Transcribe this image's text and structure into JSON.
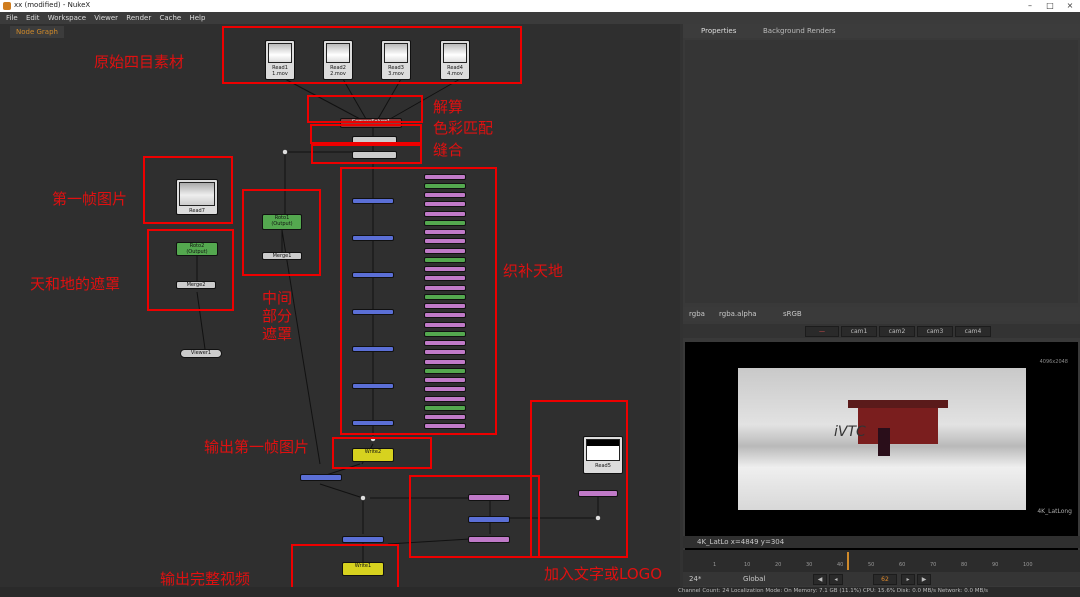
{
  "titlebar": {
    "title": "xx (modified) - NukeX"
  },
  "menu": [
    "File",
    "Edit",
    "Workspace",
    "Viewer",
    "Render",
    "Cache",
    "Help"
  ],
  "graph_tab": "Node Graph",
  "right_tabs": {
    "properties": "Properties",
    "bg_renders": "Background Renders"
  },
  "reads": [
    {
      "name": "Read1",
      "file": "1.mov"
    },
    {
      "name": "Read2",
      "file": "2.mov"
    },
    {
      "name": "Read3",
      "file": "3.mov"
    },
    {
      "name": "Read4",
      "file": "4.mov"
    }
  ],
  "nodes": {
    "camerasolver": "CameraSolver1",
    "read7": "Read7",
    "roto1": "Roto1",
    "roto1_sub": "(Output)",
    "merge1": "Merge1",
    "roto2": "Roto2",
    "roto2_sub": "(Output)",
    "merge2": "Merge2",
    "viewer": "Viewer1",
    "write2": "Write2",
    "write1": "Write1",
    "read5": "Read5"
  },
  "annotations": {
    "raw": "原始四目素材",
    "solve": "解算",
    "color": "色彩匹配",
    "stitch": "缝合",
    "firstframe": "第一帧图片",
    "mask_sky": "天和地的遮罩",
    "mid_mask": "中间\n部分\n遮罩",
    "patch": "织补天地",
    "out_first": "输出第一帧图片",
    "text_logo": "加入文字或LOGO",
    "out_video": "输出完整视频"
  },
  "viewer": {
    "channels": "rgba",
    "channels2": "rgba.alpha",
    "colorspace": "sRGB",
    "cams": [
      "cam1",
      "cam2",
      "cam3",
      "cam4"
    ],
    "format_tr": "4096x2048",
    "format_br": "4K_LatLong",
    "status": "4K_LatLo  x=4849 y=304",
    "fps": "24*",
    "frame": "62",
    "mode": "Global"
  },
  "timeline_ticks": [
    "1",
    "10",
    "20",
    "30",
    "40",
    "50",
    "60",
    "70",
    "80",
    "90",
    "100"
  ],
  "statusbar": "Channel Count: 24  Localization Mode: On  Memory: 7.1 GB (11.1%)  CPU: 15.6%  Disk: 0.0 MB/s  Network: 0.0 MB/s",
  "colors": {
    "annotation": "#e01010",
    "read_node": "#dcdcdc",
    "roto": "#54a84f",
    "merge": "#5b6fd6",
    "grade": "#c07ac8",
    "write": "#d7d21f"
  }
}
